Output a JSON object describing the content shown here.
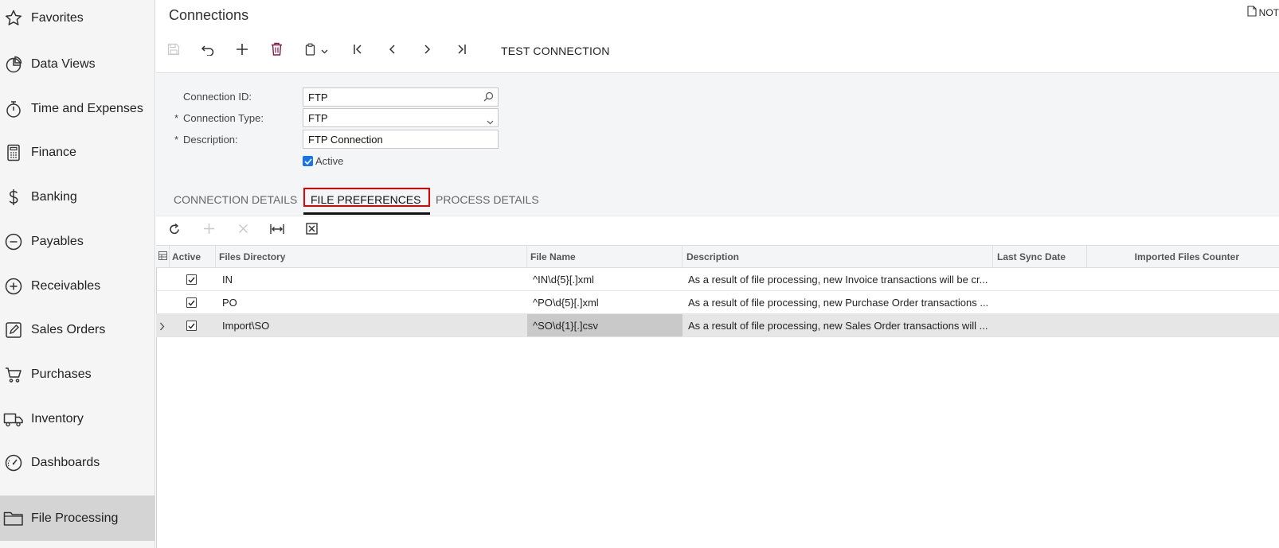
{
  "sidebar": {
    "items": [
      {
        "label": "Favorites",
        "icon": "star-icon"
      },
      {
        "label": "Data Views",
        "icon": "pie-chart-icon"
      },
      {
        "label": "Time and Expenses",
        "icon": "stopwatch-icon"
      },
      {
        "label": "Finance",
        "icon": "calculator-icon"
      },
      {
        "label": "Banking",
        "icon": "dollar-icon"
      },
      {
        "label": "Payables",
        "icon": "minus-circle-icon"
      },
      {
        "label": "Receivables",
        "icon": "plus-circle-icon"
      },
      {
        "label": "Sales Orders",
        "icon": "edit-icon"
      },
      {
        "label": "Purchases",
        "icon": "cart-icon"
      },
      {
        "label": "Inventory",
        "icon": "truck-icon"
      },
      {
        "label": "Dashboards",
        "icon": "gauge-icon"
      },
      {
        "label": "File Processing",
        "icon": "folder-icon",
        "active": true
      }
    ]
  },
  "header": {
    "title": "Connections",
    "notes_label": "NOT"
  },
  "toolbar": {
    "test_connection": "TEST CONNECTION"
  },
  "form": {
    "connection_id_label": "Connection ID:",
    "connection_id_value": "FTP",
    "connection_type_label": "Connection Type:",
    "connection_type_value": "FTP",
    "description_label": "Description:",
    "description_value": "FTP Connection",
    "required_mark": "*",
    "active_label": "Active",
    "active_checked": true
  },
  "tabs": [
    {
      "label": "CONNECTION DETAILS"
    },
    {
      "label": "FILE PREFERENCES",
      "active": true
    },
    {
      "label": "PROCESS DETAILS"
    }
  ],
  "grid": {
    "columns": {
      "active": "Active",
      "files_directory": "Files Directory",
      "file_name": "File Name",
      "description": "Description",
      "last_sync_date": "Last Sync Date",
      "imported_files_counter": "Imported Files Counter"
    },
    "rows": [
      {
        "active": true,
        "files_directory": "IN",
        "file_name": "^IN\\d{5}[.]xml",
        "description": "As a result of file processing, new Invoice transactions will be cr...",
        "last_sync_date": "",
        "imported_files_counter": ""
      },
      {
        "active": true,
        "files_directory": "PO",
        "file_name": "^PO\\d{5}[.]xml",
        "description": "As a result of file processing, new Purchase Order transactions ...",
        "last_sync_date": "",
        "imported_files_counter": ""
      },
      {
        "active": true,
        "files_directory": "Import\\SO",
        "file_name": "^SO\\d{1}[.]csv",
        "description": "As a result of file processing, new Sales Order transactions will ...",
        "last_sync_date": "",
        "imported_files_counter": "",
        "selected": true
      }
    ]
  },
  "colors": {
    "highlight_border": "#e00000",
    "checkbox_blue": "#1a73e8",
    "sidebar_active": "#d4d4d4"
  }
}
